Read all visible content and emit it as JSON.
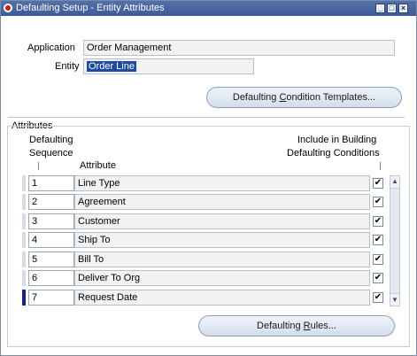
{
  "window": {
    "title": "Defaulting Setup - Entity Attributes",
    "controls": [
      "minimize-icon",
      "maximize-icon",
      "close-icon"
    ]
  },
  "form": {
    "application_label": "Application",
    "application_value": "Order Management",
    "entity_label": "Entity",
    "entity_value": "Order Line"
  },
  "buttons": {
    "condition_templates_pre": "Defaulting ",
    "condition_templates_key": "C",
    "condition_templates_post": "ondition Templates...",
    "rules_pre": "Defaulting ",
    "rules_key": "R",
    "rules_post": "ules..."
  },
  "attributes": {
    "section_title": "Attributes",
    "col_sequence_line1": "Defaulting",
    "col_sequence_line2": "Sequence",
    "col_attribute": "Attribute",
    "col_include_line1": "Include in Building",
    "col_include_line2": "Defaulting Conditions",
    "rows": [
      {
        "seq": "1",
        "attribute": "Line Type",
        "include": true,
        "check": "✔"
      },
      {
        "seq": "2",
        "attribute": "Agreement",
        "include": true,
        "check": "✔"
      },
      {
        "seq": "3",
        "attribute": "Customer",
        "include": true,
        "check": "✔"
      },
      {
        "seq": "4",
        "attribute": "Ship To",
        "include": true,
        "check": "✔"
      },
      {
        "seq": "5",
        "attribute": "Bill To",
        "include": true,
        "check": "✔"
      },
      {
        "seq": "6",
        "attribute": "Deliver To Org",
        "include": true,
        "check": "✔"
      },
      {
        "seq": "7",
        "attribute": "Request Date",
        "include": true,
        "check": "✔"
      }
    ],
    "current_row": 7
  },
  "colors": {
    "titlebar": "#4763a0",
    "selection": "#1f4aa0",
    "current_row_indicator": "#16237a"
  }
}
